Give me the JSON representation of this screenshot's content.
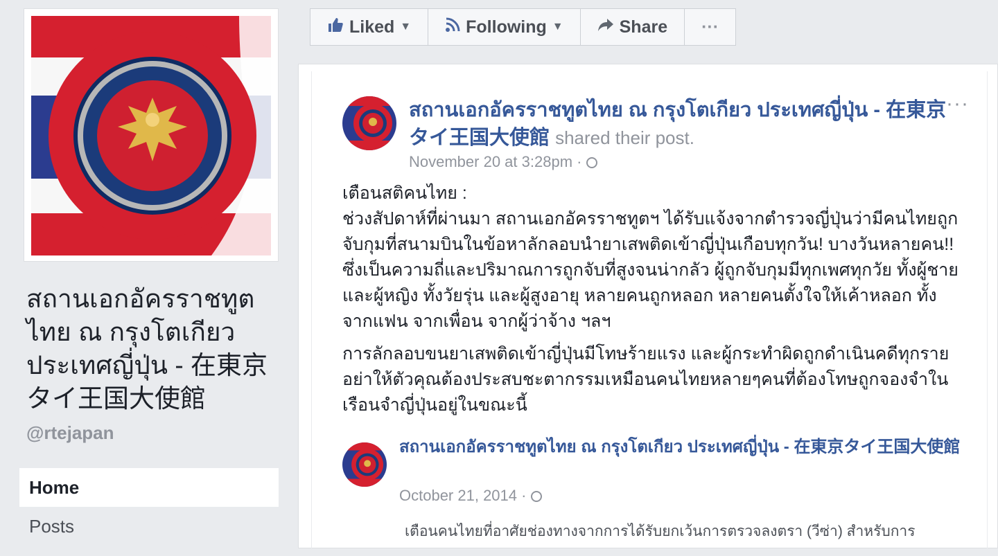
{
  "left": {
    "page_name": "สถานเอกอัครราชทูตไทย ณ กรุงโตเกียว ประเทศญี่ปุ่น - 在東京タイ王国大使館",
    "handle": "@rtejapan",
    "nav": [
      {
        "label": "Home"
      },
      {
        "label": "Posts"
      }
    ]
  },
  "actions": {
    "liked": "Liked",
    "following": "Following",
    "share": "Share",
    "more": "···"
  },
  "post": {
    "author": "สถานเอกอัครราชทูตไทย ณ กรุงโตเกียว ประเทศญี่ปุ่น - 在東京タイ王国大使館",
    "shared_text": "shared their post.",
    "timestamp": "November 20 at 3:28pm ·",
    "more": "···",
    "body_p1": "เตือนสติคนไทย :\nช่วงสัปดาห์ที่ผ่านมา สถานเอกอัครราชทูตฯ ได้รับแจ้งจากตำรวจญี่ปุ่นว่ามีคนไทยถูกจับกุมที่สนามบินในข้อหาลักลอบนำยาเสพติดเข้าญี่ปุ่นเกือบทุกวัน! บางวันหลายคน!! ซึ่งเป็นความถี่และปริมาณการถูกจับที่สูงจนน่ากลัว ผู้ถูกจับกุมมีทุกเพศทุกวัย ทั้งผู้ชาย และผู้หญิง ทั้งวัยรุ่น และผู้สูงอายุ หลายคนถูกหลอก หลายคนตั้งใจให้เค้าหลอก ทั้งจากแฟน จากเพื่อน จากผู้ว่าจ้าง ฯลฯ",
    "body_p2": "การลักลอบขนยาเสพติดเข้าญี่ปุ่นมีโทษร้ายแรง และผู้กระทำผิดถูกดำเนินคดีทุกราย อย่าให้ตัวคุณต้องประสบชะตากรรมเหมือนคนไทยหลายๆคนที่ต้องโทษถูกจองจำในเรือนจำญี่ปุ่นอยู่ในขณะนี้"
  },
  "shared_post": {
    "author": "สถานเอกอัครราชทูตไทย ณ กรุงโตเกียว ประเทศญี่ปุ่น - 在東京タイ王国大使館",
    "timestamp": "October 21, 2014 ·",
    "body": "เตือนคนไทยที่อาศัยช่องทางจากการได้รับยกเว้นการตรวจลงตรา (วีซ่า) สำหรับการ"
  },
  "colors": {
    "link_blue": "#365899",
    "thai_red": "#d5202f",
    "thai_blue": "#2b3c8f"
  }
}
